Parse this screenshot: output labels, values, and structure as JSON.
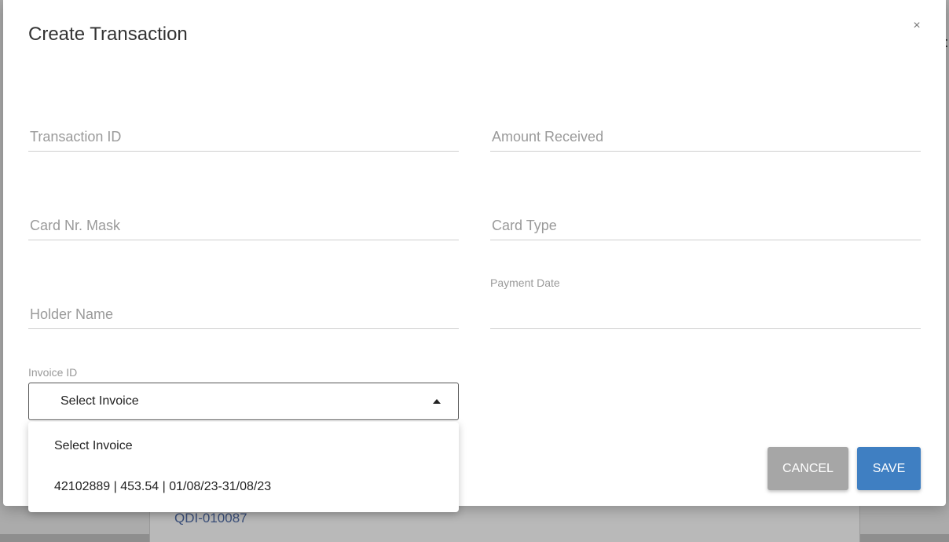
{
  "background": {
    "link_text": "QDI-010087",
    "edge_char": "t"
  },
  "modal": {
    "title": "Create Transaction",
    "close_icon": "×"
  },
  "fields": {
    "transaction_id": {
      "placeholder": "Transaction ID",
      "value": ""
    },
    "amount_received": {
      "placeholder": "Amount Received",
      "value": ""
    },
    "card_nr_mask": {
      "placeholder": "Card Nr. Mask",
      "value": ""
    },
    "card_type": {
      "placeholder": "Card Type",
      "value": ""
    },
    "holder_name": {
      "placeholder": "Holder Name",
      "value": ""
    },
    "payment_date": {
      "label": "Payment Date",
      "value": ""
    }
  },
  "invoice": {
    "label": "Invoice ID",
    "selected": "Select Invoice",
    "options": [
      "Select Invoice",
      "42102889 | 453.54 | 01/08/23-31/08/23"
    ]
  },
  "buttons": {
    "cancel": "CANCEL",
    "save": "SAVE"
  },
  "colors": {
    "save": "#3f7fc2",
    "cancel": "#a6a6a6"
  }
}
